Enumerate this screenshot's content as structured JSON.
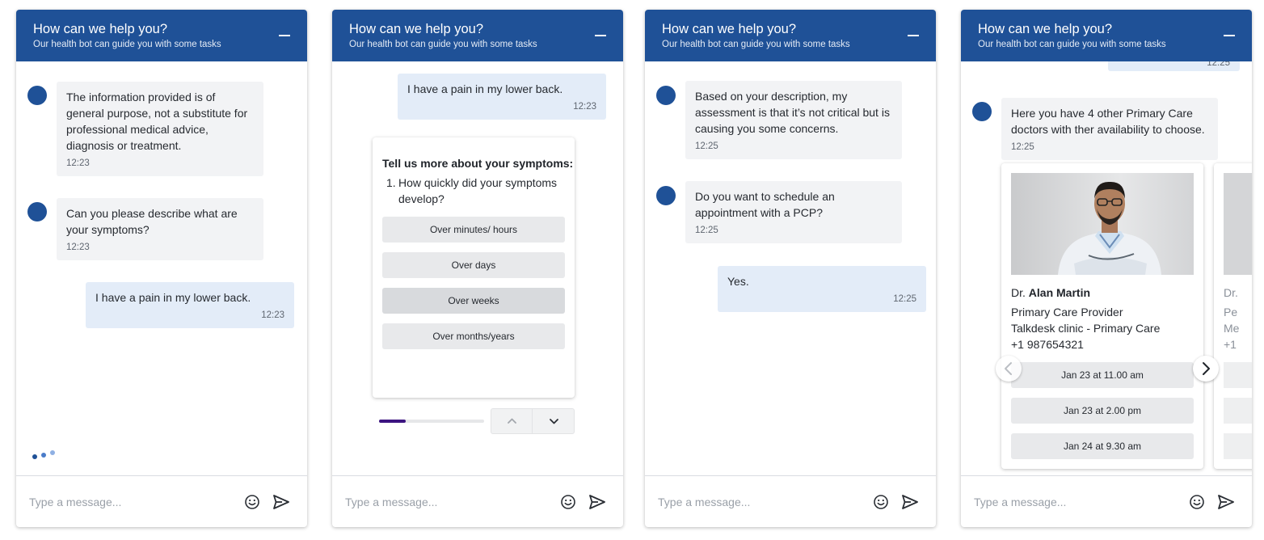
{
  "header": {
    "title": "How can we help you?",
    "subtitle": "Our health bot can guide you with some tasks"
  },
  "footer": {
    "placeholder": "Type a message..."
  },
  "panel1": {
    "messages": [
      {
        "text": "The information provided is of general purpose, not a substitute for professional medical advice, diagnosis or treatment.",
        "time": "12:23"
      },
      {
        "text": "Can you please describe what are your symptoms?",
        "time": "12:23"
      },
      {
        "text": "I have a pain in my lower back.",
        "time": "12:23"
      }
    ]
  },
  "panel2": {
    "user_message": {
      "text": "I have a pain in my lower back.",
      "time": "12:23"
    },
    "survey": {
      "title": "Tell us more about your symptoms:",
      "question_number": "1.",
      "question": "How quickly did your symptoms develop?",
      "options": [
        "Over minutes/ hours",
        "Over days",
        "Over weeks",
        "Over months/years"
      ]
    },
    "progress_fraction": 0.25
  },
  "panel3": {
    "messages": [
      {
        "text": "Based on your description, my assessment is that it’s not critical but is causing you some concerns.",
        "time": "12:25"
      },
      {
        "text": "Do you want to schedule an appointment with a PCP?",
        "time": "12:25"
      },
      {
        "text": "Yes.",
        "time": "12:25"
      }
    ]
  },
  "panel4": {
    "prev_time": "12:25",
    "bot_message": {
      "text": "Here you have 4 other Primary Care doctors with ther availability to choose.",
      "time": "12:25"
    },
    "doctor": {
      "prefix": "Dr.",
      "name": "Alan Martin",
      "role": "Primary Care Provider",
      "clinic": "Talkdesk clinic - Primary Care",
      "phone": "+1 987654321",
      "slots": [
        "Jan 23 at 11.00 am",
        "Jan 23 at 2.00 pm",
        "Jan 24 at 9.30 am"
      ]
    },
    "peek_card": {
      "prefix": "Dr.",
      "role_fragment": "Pe",
      "clinic_fragment": "Me",
      "phone_fragment": "+1"
    }
  },
  "colors": {
    "brand": "#1f5197",
    "user_bubble": "#e3ecf8",
    "bot_bubble": "#f2f3f5",
    "progress": "#3c1480"
  },
  "icons": [
    "minimize-icon",
    "smiley-icon",
    "send-icon",
    "chevron-up-icon",
    "chevron-down-icon",
    "chevron-left-icon",
    "chevron-right-icon",
    "typing-indicator"
  ]
}
